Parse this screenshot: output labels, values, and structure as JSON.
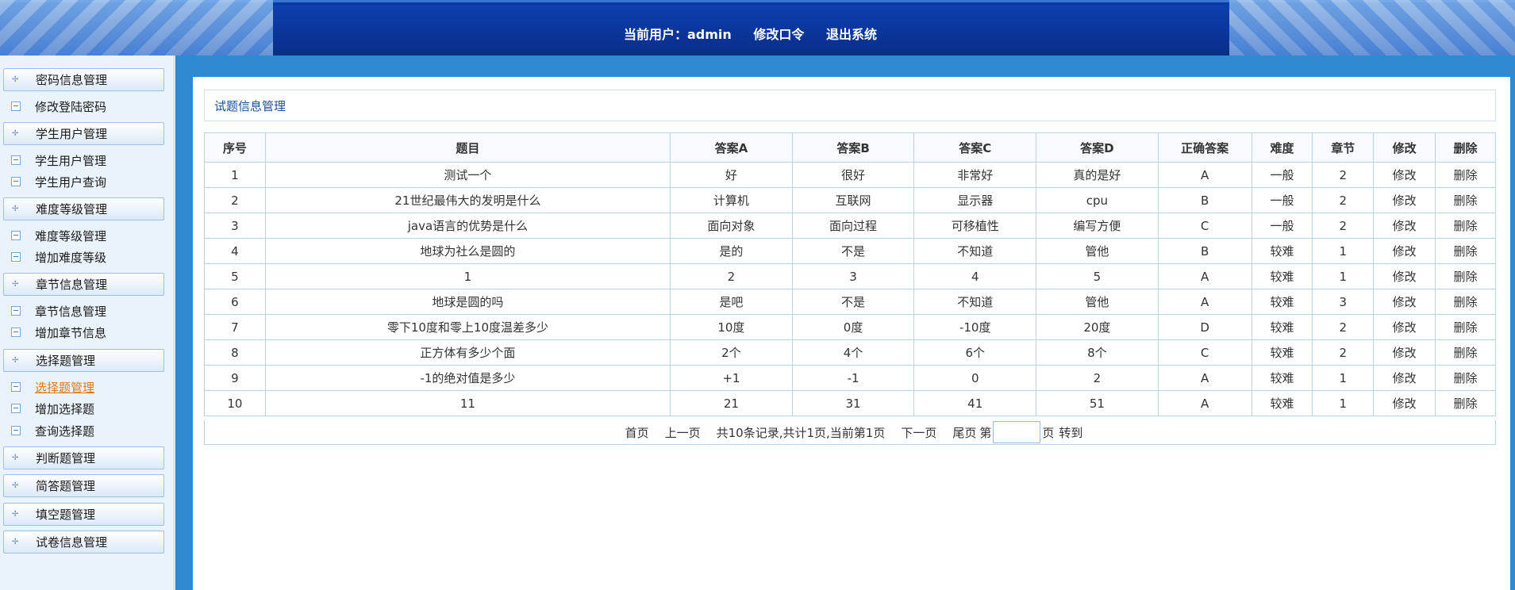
{
  "header": {
    "current_user_label": "当前用户：admin",
    "change_password": "修改口令",
    "logout": "退出系统"
  },
  "sidebar": {
    "sections": [
      {
        "title": "密码信息管理",
        "items": [
          "修改登陆密码"
        ]
      },
      {
        "title": "学生用户管理",
        "items": [
          "学生用户管理",
          "学生用户查询"
        ]
      },
      {
        "title": "难度等级管理",
        "items": [
          "难度等级管理",
          "增加难度等级"
        ]
      },
      {
        "title": "章节信息管理",
        "items": [
          "章节信息管理",
          "增加章节信息"
        ]
      },
      {
        "title": "选择题管理",
        "items": [
          "选择题管理",
          "增加选择题",
          "查询选择题"
        ]
      },
      {
        "title": "判断题管理",
        "items": []
      },
      {
        "title": "简答题管理",
        "items": []
      },
      {
        "title": "填空题管理",
        "items": []
      },
      {
        "title": "试卷信息管理",
        "items": []
      }
    ],
    "active_item": "选择题管理"
  },
  "main": {
    "title": "试题信息管理",
    "table": {
      "headers": [
        "序号",
        "题目",
        "答案A",
        "答案B",
        "答案C",
        "答案D",
        "正确答案",
        "难度",
        "章节",
        "修改",
        "删除"
      ],
      "rows": [
        [
          "1",
          "测试一个",
          "好",
          "很好",
          "非常好",
          "真的是好",
          "A",
          "一般",
          "2",
          "修改",
          "删除"
        ],
        [
          "2",
          "21世纪最伟大的发明是什么",
          "计算机",
          "互联网",
          "显示器",
          "cpu",
          "B",
          "一般",
          "2",
          "修改",
          "删除"
        ],
        [
          "3",
          "java语言的优势是什么",
          "面向对象",
          "面向过程",
          "可移植性",
          "编写方便",
          "C",
          "一般",
          "2",
          "修改",
          "删除"
        ],
        [
          "4",
          "地球为社么是圆的",
          "是的",
          "不是",
          "不知道",
          "管他",
          "B",
          "较难",
          "1",
          "修改",
          "删除"
        ],
        [
          "5",
          "1",
          "2",
          "3",
          "4",
          "5",
          "A",
          "较难",
          "1",
          "修改",
          "删除"
        ],
        [
          "6",
          "地球是圆的吗",
          "是吧",
          "不是",
          "不知道",
          "管他",
          "A",
          "较难",
          "3",
          "修改",
          "删除"
        ],
        [
          "7",
          "零下10度和零上10度温差多少",
          "10度",
          "0度",
          "-10度",
          "20度",
          "D",
          "较难",
          "2",
          "修改",
          "删除"
        ],
        [
          "8",
          "正方体有多少个面",
          "2个",
          "4个",
          "6个",
          "8个",
          "C",
          "较难",
          "2",
          "修改",
          "删除"
        ],
        [
          "9",
          "-1的绝对值是多少",
          "+1",
          "-1",
          "0",
          "2",
          "A",
          "较难",
          "1",
          "修改",
          "删除"
        ],
        [
          "10",
          "11",
          "21",
          "31",
          "41",
          "51",
          "A",
          "较难",
          "1",
          "修改",
          "删除"
        ]
      ]
    },
    "pager": {
      "first": "首页",
      "prev": "上一页",
      "summary": "共10条记录,共计1页,当前第1页",
      "next": "下一页",
      "last": "尾页",
      "page_prefix": "第",
      "page_suffix": "页",
      "goto": "转到",
      "page_input_value": ""
    }
  }
}
